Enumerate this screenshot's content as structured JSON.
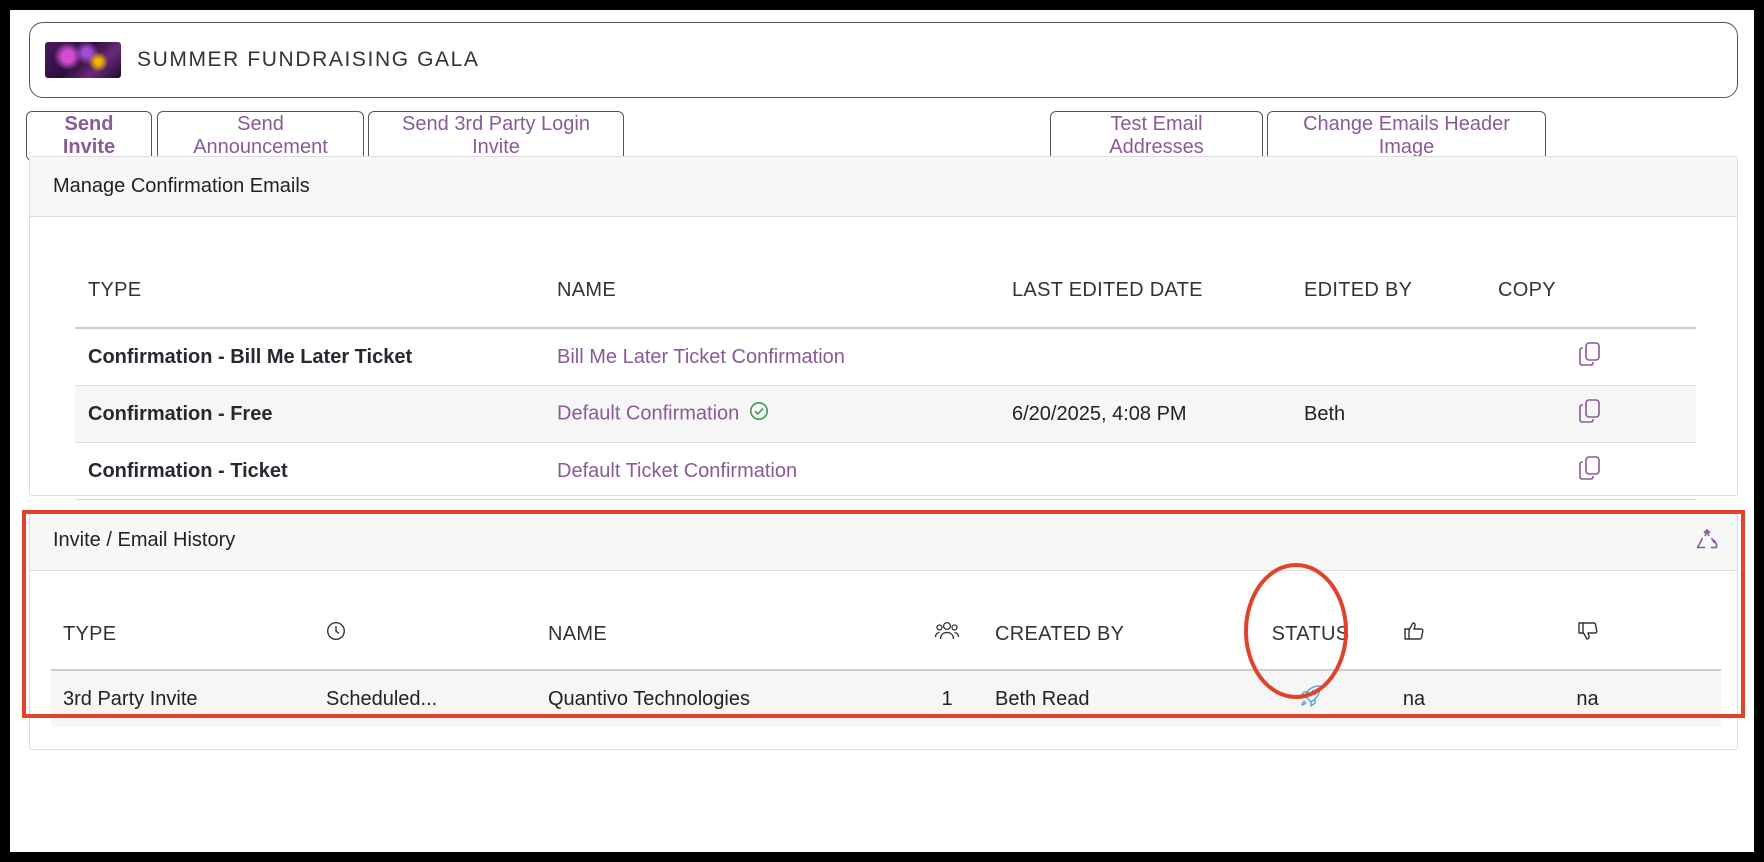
{
  "event": {
    "title": "SUMMER FUNDRAISING GALA"
  },
  "actions": {
    "send_invite": "Send Invite",
    "send_announcement": "Send Announcement",
    "send_3rd_party": "Send 3rd Party Login Invite",
    "test_emails": "Test Email Addresses",
    "change_header_image": "Change Emails Header Image"
  },
  "confirmation": {
    "title": "Manage Confirmation Emails",
    "columns": {
      "type": "TYPE",
      "name": "NAME",
      "last_edited": "LAST EDITED DATE",
      "edited_by": "EDITED BY",
      "copy": "COPY"
    },
    "rows": [
      {
        "type": "Confirmation - Bill Me Later Ticket",
        "name": "Bill Me Later Ticket Confirmation",
        "last_edited": "",
        "edited_by": "",
        "default": false
      },
      {
        "type": "Confirmation - Free",
        "name": "Default Confirmation",
        "last_edited": "6/20/2025, 4:08 PM",
        "edited_by": "Beth",
        "default": true
      },
      {
        "type": "Confirmation - Ticket",
        "name": "Default Ticket Confirmation",
        "last_edited": "",
        "edited_by": "",
        "default": false
      }
    ]
  },
  "history": {
    "title": "Invite / Email History",
    "columns": {
      "type": "TYPE",
      "name": "NAME",
      "created_by": "CREATED BY",
      "status": "STATUS"
    },
    "column_icons": {
      "time": "clock-icon",
      "recipients": "people-icon",
      "likes": "thumbs-up-icon",
      "dislikes": "thumbs-down-icon"
    },
    "rows": [
      {
        "type": "3rd Party Invite",
        "time": "Scheduled...",
        "name": "Quantivo Technologies",
        "recipients": "1",
        "created_by": "Beth Read",
        "status_icon": "rocket-icon",
        "likes": "na",
        "dislikes": "na"
      }
    ]
  },
  "colors": {
    "accent": "#8a5a98",
    "annotation": "#e2412c",
    "success": "#3a9a4a",
    "status_icon": "#5aa9d6"
  }
}
